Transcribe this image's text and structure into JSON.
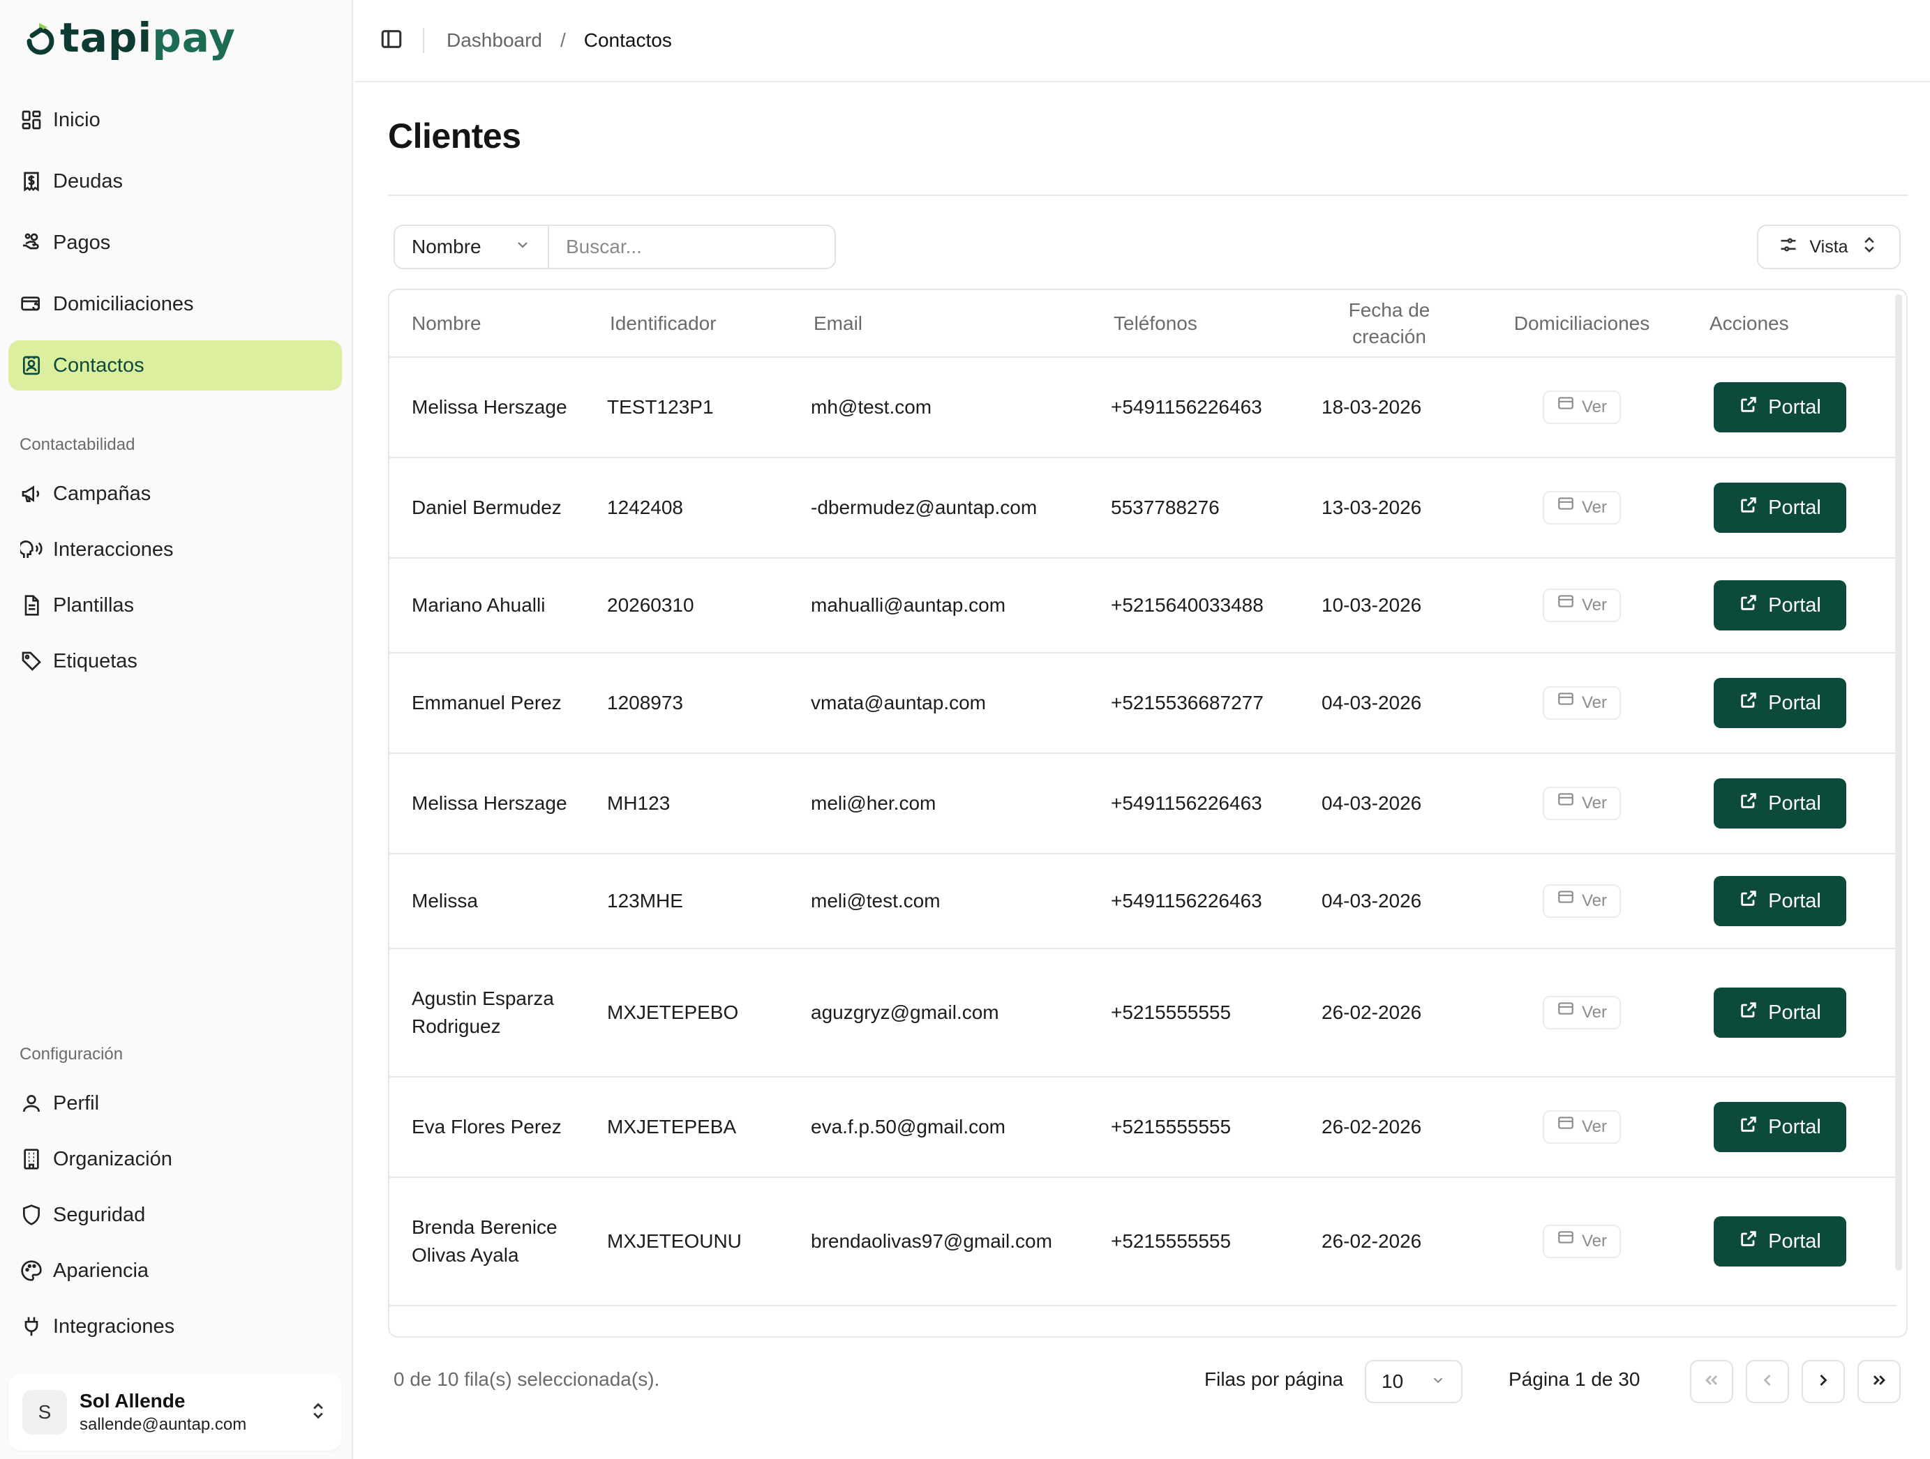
{
  "brand": {
    "name_part1": "tapi",
    "name_part2": "pay",
    "primary_color": "#0c4a3c",
    "active_bg": "#dcef9f"
  },
  "sidebar": {
    "main_items": [
      {
        "label": "Inicio",
        "icon": "dashboard-icon"
      },
      {
        "label": "Deudas",
        "icon": "receipt-dollar-icon"
      },
      {
        "label": "Pagos",
        "icon": "hand-coins-icon"
      },
      {
        "label": "Domiciliaciones",
        "icon": "card-refresh-icon"
      },
      {
        "label": "Contactos",
        "icon": "contact-book-icon",
        "active": true
      }
    ],
    "section_contact": "Contactabilidad",
    "contact_items": [
      {
        "label": "Campañas",
        "icon": "megaphone-icon"
      },
      {
        "label": "Interacciones",
        "icon": "speaking-head-icon"
      },
      {
        "label": "Plantillas",
        "icon": "document-icon"
      },
      {
        "label": "Etiquetas",
        "icon": "tag-icon"
      }
    ],
    "section_config": "Configuración",
    "config_items": [
      {
        "label": "Perfil",
        "icon": "user-icon"
      },
      {
        "label": "Organización",
        "icon": "building-icon"
      },
      {
        "label": "Seguridad",
        "icon": "shield-icon"
      },
      {
        "label": "Apariencia",
        "icon": "palette-icon"
      },
      {
        "label": "Integraciones",
        "icon": "plug-icon"
      }
    ],
    "user": {
      "initial": "S",
      "name": "Sol Allende",
      "email": "sallende@auntap.com"
    }
  },
  "topbar": {
    "breadcrumb_root": "Dashboard",
    "breadcrumb_sep": "/",
    "breadcrumb_current": "Contactos"
  },
  "page": {
    "title": "Clientes"
  },
  "filters": {
    "field_select": "Nombre",
    "search_placeholder": "Buscar...",
    "view_button": "Vista"
  },
  "table": {
    "columns": {
      "name": "Nombre",
      "identifier": "Identificador",
      "email": "Email",
      "phones": "Teléfonos",
      "created": "Fecha de creación",
      "direct_debits": "Domiciliaciones",
      "actions": "Acciones"
    },
    "ver_label": "Ver",
    "portal_label": "Portal",
    "rows": [
      {
        "name": "Melissa Herszage",
        "identifier": "TEST123P1",
        "email": "mh@test.com",
        "phone": "+5491156226463",
        "created": "18-03-2026"
      },
      {
        "name": "Daniel Bermudez",
        "identifier": "1242408",
        "email": "-dbermudez@auntap.com",
        "phone": "5537788276",
        "created": "13-03-2026"
      },
      {
        "name": "Mariano Ahualli",
        "identifier": "20260310",
        "email": "mahualli@auntap.com",
        "phone": "+5215640033488",
        "created": "10-03-2026"
      },
      {
        "name": "Emmanuel Perez",
        "identifier": "1208973",
        "email": "vmata@auntap.com",
        "phone": "+5215536687277",
        "created": "04-03-2026"
      },
      {
        "name": "Melissa Herszage",
        "identifier": "MH123",
        "email": "meli@her.com",
        "phone": "+5491156226463",
        "created": "04-03-2026"
      },
      {
        "name": "Melissa",
        "identifier": "123MHE",
        "email": "meli@test.com",
        "phone": "+5491156226463",
        "created": "04-03-2026"
      },
      {
        "name": "Agustin Esparza Rodriguez",
        "identifier": "MXJETEPEBO",
        "email": "aguzgryz@gmail.com",
        "phone": "+5215555555",
        "created": "26-02-2026"
      },
      {
        "name": "Eva Flores Perez",
        "identifier": "MXJETEPEBA",
        "email": "eva.f.p.50@gmail.com",
        "phone": "+5215555555",
        "created": "26-02-2026"
      },
      {
        "name": "Brenda Berenice Olivas Ayala",
        "identifier": "MXJETEOUNU",
        "email": "brendaolivas97@gmail.com",
        "phone": "+5215555555",
        "created": "26-02-2026"
      }
    ]
  },
  "footer": {
    "selected_text": "0 de 10 fila(s) seleccionada(s).",
    "rows_per_page_label": "Filas por página",
    "rows_per_page_value": "10",
    "page_label": "Página 1 de 30"
  }
}
